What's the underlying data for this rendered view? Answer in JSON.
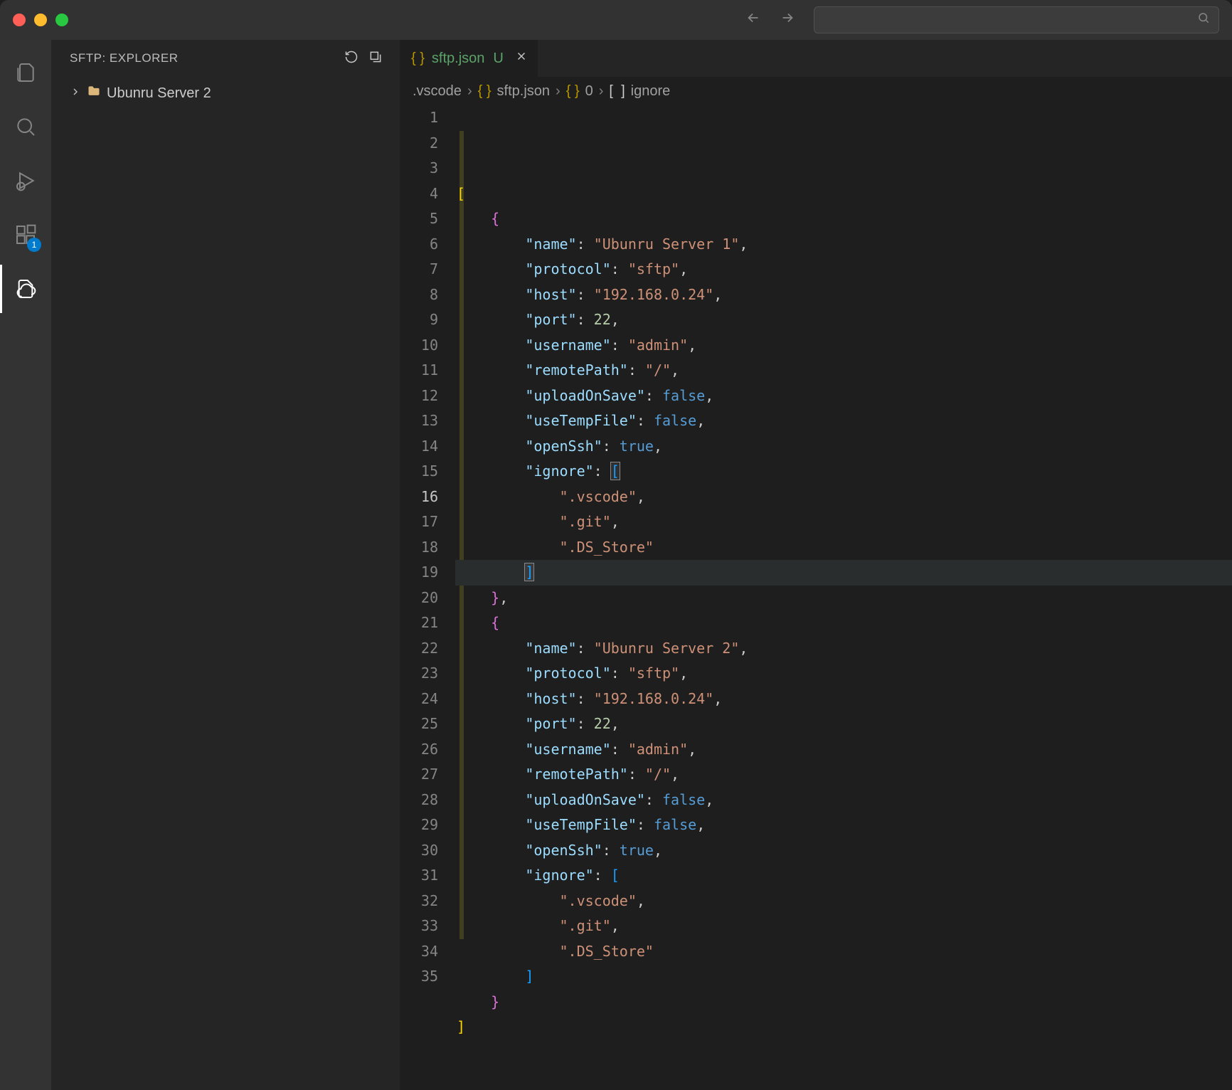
{
  "titleBar": {
    "navBackEnabled": false,
    "navForwardEnabled": false
  },
  "activityBar": {
    "items": [
      {
        "name": "explorer",
        "label": "Explorer"
      },
      {
        "name": "search",
        "label": "Search"
      },
      {
        "name": "debug",
        "label": "Run and Debug"
      },
      {
        "name": "extensions",
        "label": "Extensions",
        "badge": "1"
      },
      {
        "name": "sftp",
        "label": "SFTP",
        "active": true
      }
    ]
  },
  "sidebar": {
    "title": "SFTP: EXPLORER",
    "tree": [
      {
        "label": "Ubunru Server 2",
        "kind": "folder"
      }
    ]
  },
  "tabs": [
    {
      "file": "sftp.json",
      "modifiedMark": "U",
      "active": true
    }
  ],
  "breadcrumbs": [
    {
      "label": ".vscode",
      "kind": "folder"
    },
    {
      "label": "sftp.json",
      "kind": "json"
    },
    {
      "label": "0",
      "kind": "object"
    },
    {
      "label": "ignore",
      "kind": "array"
    }
  ],
  "editor": {
    "activeLine": 16,
    "lines": [
      {
        "n": 1,
        "tokens": [
          {
            "t": "tok-brkt",
            "v": "["
          }
        ]
      },
      {
        "n": 2,
        "tokens": [
          {
            "t": "",
            "v": "    "
          },
          {
            "t": "tok-brkt2",
            "v": "{"
          }
        ]
      },
      {
        "n": 3,
        "tokens": [
          {
            "t": "",
            "v": "        "
          },
          {
            "t": "tok-key",
            "v": "\"name\""
          },
          {
            "t": "tok-punc",
            "v": ": "
          },
          {
            "t": "tok-str",
            "v": "\"Ubunru Server 1\""
          },
          {
            "t": "tok-punc",
            "v": ","
          }
        ]
      },
      {
        "n": 4,
        "tokens": [
          {
            "t": "",
            "v": "        "
          },
          {
            "t": "tok-key",
            "v": "\"protocol\""
          },
          {
            "t": "tok-punc",
            "v": ": "
          },
          {
            "t": "tok-str",
            "v": "\"sftp\""
          },
          {
            "t": "tok-punc",
            "v": ","
          }
        ]
      },
      {
        "n": 5,
        "tokens": [
          {
            "t": "",
            "v": "        "
          },
          {
            "t": "tok-key",
            "v": "\"host\""
          },
          {
            "t": "tok-punc",
            "v": ": "
          },
          {
            "t": "tok-str",
            "v": "\"192.168.0.24\""
          },
          {
            "t": "tok-punc",
            "v": ","
          }
        ]
      },
      {
        "n": 6,
        "tokens": [
          {
            "t": "",
            "v": "        "
          },
          {
            "t": "tok-key",
            "v": "\"port\""
          },
          {
            "t": "tok-punc",
            "v": ": "
          },
          {
            "t": "tok-num",
            "v": "22"
          },
          {
            "t": "tok-punc",
            "v": ","
          }
        ]
      },
      {
        "n": 7,
        "tokens": [
          {
            "t": "",
            "v": "        "
          },
          {
            "t": "tok-key",
            "v": "\"username\""
          },
          {
            "t": "tok-punc",
            "v": ": "
          },
          {
            "t": "tok-str",
            "v": "\"admin\""
          },
          {
            "t": "tok-punc",
            "v": ","
          }
        ]
      },
      {
        "n": 8,
        "tokens": [
          {
            "t": "",
            "v": "        "
          },
          {
            "t": "tok-key",
            "v": "\"remotePath\""
          },
          {
            "t": "tok-punc",
            "v": ": "
          },
          {
            "t": "tok-str",
            "v": "\"/\""
          },
          {
            "t": "tok-punc",
            "v": ","
          }
        ]
      },
      {
        "n": 9,
        "tokens": [
          {
            "t": "",
            "v": "        "
          },
          {
            "t": "tok-key",
            "v": "\"uploadOnSave\""
          },
          {
            "t": "tok-punc",
            "v": ": "
          },
          {
            "t": "tok-bool",
            "v": "false"
          },
          {
            "t": "tok-punc",
            "v": ","
          }
        ]
      },
      {
        "n": 10,
        "tokens": [
          {
            "t": "",
            "v": "        "
          },
          {
            "t": "tok-key",
            "v": "\"useTempFile\""
          },
          {
            "t": "tok-punc",
            "v": ": "
          },
          {
            "t": "tok-bool",
            "v": "false"
          },
          {
            "t": "tok-punc",
            "v": ","
          }
        ]
      },
      {
        "n": 11,
        "tokens": [
          {
            "t": "",
            "v": "        "
          },
          {
            "t": "tok-key",
            "v": "\"openSsh\""
          },
          {
            "t": "tok-punc",
            "v": ": "
          },
          {
            "t": "tok-bool",
            "v": "true"
          },
          {
            "t": "tok-punc",
            "v": ","
          }
        ]
      },
      {
        "n": 12,
        "tokens": [
          {
            "t": "",
            "v": "        "
          },
          {
            "t": "tok-key",
            "v": "\"ignore\""
          },
          {
            "t": "tok-punc",
            "v": ": "
          },
          {
            "t": "tok-brkt3 match",
            "v": "["
          }
        ]
      },
      {
        "n": 13,
        "tokens": [
          {
            "t": "",
            "v": "            "
          },
          {
            "t": "tok-str",
            "v": "\".vscode\""
          },
          {
            "t": "tok-punc",
            "v": ","
          }
        ]
      },
      {
        "n": 14,
        "tokens": [
          {
            "t": "",
            "v": "            "
          },
          {
            "t": "tok-str",
            "v": "\".git\""
          },
          {
            "t": "tok-punc",
            "v": ","
          }
        ]
      },
      {
        "n": 15,
        "tokens": [
          {
            "t": "",
            "v": "            "
          },
          {
            "t": "tok-str",
            "v": "\".DS_Store\""
          }
        ]
      },
      {
        "n": 16,
        "tokens": [
          {
            "t": "",
            "v": "        "
          },
          {
            "t": "tok-brkt3 match",
            "v": "]"
          }
        ]
      },
      {
        "n": 17,
        "tokens": [
          {
            "t": "",
            "v": "    "
          },
          {
            "t": "tok-brkt2",
            "v": "}"
          },
          {
            "t": "tok-punc",
            "v": ","
          }
        ]
      },
      {
        "n": 18,
        "tokens": [
          {
            "t": "",
            "v": "    "
          },
          {
            "t": "tok-brkt2",
            "v": "{"
          }
        ]
      },
      {
        "n": 19,
        "tokens": [
          {
            "t": "",
            "v": "        "
          },
          {
            "t": "tok-key",
            "v": "\"name\""
          },
          {
            "t": "tok-punc",
            "v": ": "
          },
          {
            "t": "tok-str",
            "v": "\"Ubunru Server 2\""
          },
          {
            "t": "tok-punc",
            "v": ","
          }
        ]
      },
      {
        "n": 20,
        "tokens": [
          {
            "t": "",
            "v": "        "
          },
          {
            "t": "tok-key",
            "v": "\"protocol\""
          },
          {
            "t": "tok-punc",
            "v": ": "
          },
          {
            "t": "tok-str",
            "v": "\"sftp\""
          },
          {
            "t": "tok-punc",
            "v": ","
          }
        ]
      },
      {
        "n": 21,
        "tokens": [
          {
            "t": "",
            "v": "        "
          },
          {
            "t": "tok-key",
            "v": "\"host\""
          },
          {
            "t": "tok-punc",
            "v": ": "
          },
          {
            "t": "tok-str",
            "v": "\"192.168.0.24\""
          },
          {
            "t": "tok-punc",
            "v": ","
          }
        ]
      },
      {
        "n": 22,
        "tokens": [
          {
            "t": "",
            "v": "        "
          },
          {
            "t": "tok-key",
            "v": "\"port\""
          },
          {
            "t": "tok-punc",
            "v": ": "
          },
          {
            "t": "tok-num",
            "v": "22"
          },
          {
            "t": "tok-punc",
            "v": ","
          }
        ]
      },
      {
        "n": 23,
        "tokens": [
          {
            "t": "",
            "v": "        "
          },
          {
            "t": "tok-key",
            "v": "\"username\""
          },
          {
            "t": "tok-punc",
            "v": ": "
          },
          {
            "t": "tok-str",
            "v": "\"admin\""
          },
          {
            "t": "tok-punc",
            "v": ","
          }
        ]
      },
      {
        "n": 24,
        "tokens": [
          {
            "t": "",
            "v": "        "
          },
          {
            "t": "tok-key",
            "v": "\"remotePath\""
          },
          {
            "t": "tok-punc",
            "v": ": "
          },
          {
            "t": "tok-str",
            "v": "\"/\""
          },
          {
            "t": "tok-punc",
            "v": ","
          }
        ]
      },
      {
        "n": 25,
        "tokens": [
          {
            "t": "",
            "v": "        "
          },
          {
            "t": "tok-key",
            "v": "\"uploadOnSave\""
          },
          {
            "t": "tok-punc",
            "v": ": "
          },
          {
            "t": "tok-bool",
            "v": "false"
          },
          {
            "t": "tok-punc",
            "v": ","
          }
        ]
      },
      {
        "n": 26,
        "tokens": [
          {
            "t": "",
            "v": "        "
          },
          {
            "t": "tok-key",
            "v": "\"useTempFile\""
          },
          {
            "t": "tok-punc",
            "v": ": "
          },
          {
            "t": "tok-bool",
            "v": "false"
          },
          {
            "t": "tok-punc",
            "v": ","
          }
        ]
      },
      {
        "n": 27,
        "tokens": [
          {
            "t": "",
            "v": "        "
          },
          {
            "t": "tok-key",
            "v": "\"openSsh\""
          },
          {
            "t": "tok-punc",
            "v": ": "
          },
          {
            "t": "tok-bool",
            "v": "true"
          },
          {
            "t": "tok-punc",
            "v": ","
          }
        ]
      },
      {
        "n": 28,
        "tokens": [
          {
            "t": "",
            "v": "        "
          },
          {
            "t": "tok-key",
            "v": "\"ignore\""
          },
          {
            "t": "tok-punc",
            "v": ": "
          },
          {
            "t": "tok-brkt3",
            "v": "["
          }
        ]
      },
      {
        "n": 29,
        "tokens": [
          {
            "t": "",
            "v": "            "
          },
          {
            "t": "tok-str",
            "v": "\".vscode\""
          },
          {
            "t": "tok-punc",
            "v": ","
          }
        ]
      },
      {
        "n": 30,
        "tokens": [
          {
            "t": "",
            "v": "            "
          },
          {
            "t": "tok-str",
            "v": "\".git\""
          },
          {
            "t": "tok-punc",
            "v": ","
          }
        ]
      },
      {
        "n": 31,
        "tokens": [
          {
            "t": "",
            "v": "            "
          },
          {
            "t": "tok-str",
            "v": "\".DS_Store\""
          }
        ]
      },
      {
        "n": 32,
        "tokens": [
          {
            "t": "",
            "v": "        "
          },
          {
            "t": "tok-brkt3",
            "v": "]"
          }
        ]
      },
      {
        "n": 33,
        "tokens": [
          {
            "t": "",
            "v": "    "
          },
          {
            "t": "tok-brkt2",
            "v": "}"
          }
        ]
      },
      {
        "n": 34,
        "tokens": [
          {
            "t": "tok-brkt",
            "v": "]"
          }
        ]
      },
      {
        "n": 35,
        "tokens": []
      }
    ]
  }
}
